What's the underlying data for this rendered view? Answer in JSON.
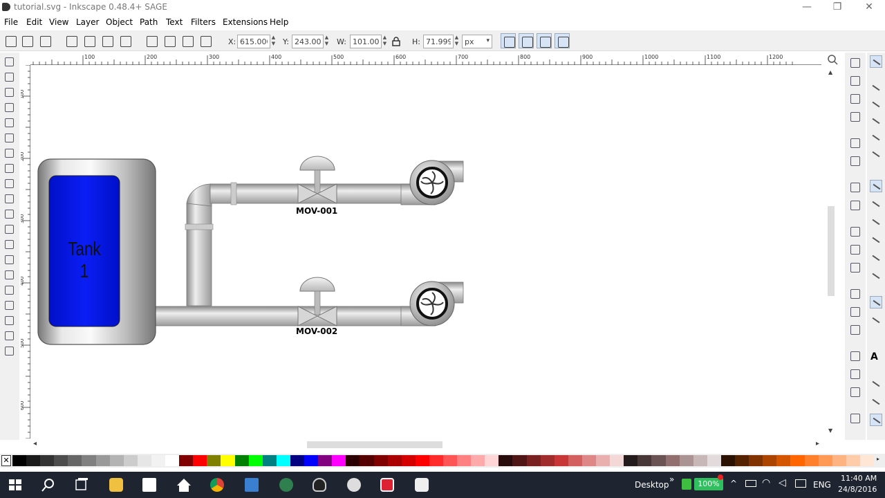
{
  "window": {
    "title": "tutorial.svg - Inkscape 0.48.4+ SAGE",
    "minimize": "—",
    "maximize": "❐",
    "close": "✕"
  },
  "menu": [
    "File",
    "Edit",
    "View",
    "Layer",
    "Object",
    "Path",
    "Text",
    "Filters",
    "Extensions",
    "Help"
  ],
  "toolctl": {
    "x_label": "X:",
    "x_value": "615.000",
    "y_label": "Y:",
    "y_value": "243.000",
    "w_label": "W:",
    "w_value": "101.009",
    "h_label": "H:",
    "h_value": "71.999",
    "unit": "px"
  },
  "ruler": {
    "h_labels": [
      "100",
      "200",
      "300",
      "400",
      "500",
      "600",
      "700",
      "800",
      "900",
      "1000",
      "1100",
      "1200"
    ],
    "v_labels": [
      "100",
      "200",
      "300",
      "400",
      "500",
      "600"
    ]
  },
  "drawing": {
    "tank_label": "Tank 1",
    "valve1_label": "MOV-001",
    "valve2_label": "MOV-002",
    "tank_color": "#0a1ef5"
  },
  "palette": [
    "#000000",
    "#1a1a1a",
    "#333333",
    "#4d4d4d",
    "#666666",
    "#808080",
    "#999999",
    "#b3b3b3",
    "#cccccc",
    "#e6e6e6",
    "#f2f2f2",
    "#ffffff",
    "#800000",
    "#ff0000",
    "#808000",
    "#ffff00",
    "#008000",
    "#00ff00",
    "#008080",
    "#00ffff",
    "#000080",
    "#0000ff",
    "#800080",
    "#ff00ff",
    "#2b0000",
    "#550000",
    "#800000",
    "#aa0000",
    "#d40000",
    "#ff0000",
    "#ff2a2a",
    "#ff5555",
    "#ff8080",
    "#ffaaaa",
    "#ffd5d5",
    "#280b0b",
    "#501616",
    "#782121",
    "#a02c2c",
    "#c83737",
    "#d35f5f",
    "#de8787",
    "#e9afaf",
    "#f4d7d7",
    "#241c1c",
    "#483737",
    "#6c5353",
    "#916f6f",
    "#ac9393",
    "#c8b7b7",
    "#e3dbdb",
    "#2b1100",
    "#552200",
    "#803300",
    "#aa4400",
    "#d45500",
    "#ff6600",
    "#ff7f2a",
    "#ff9955",
    "#ffb380",
    "#ffccaa",
    "#ffe6d5"
  ],
  "taskbar": {
    "tray_desktop": "Desktop",
    "battery": "100%",
    "lang": "ENG",
    "time": "11:40 AM",
    "date": "24/8/2016"
  }
}
